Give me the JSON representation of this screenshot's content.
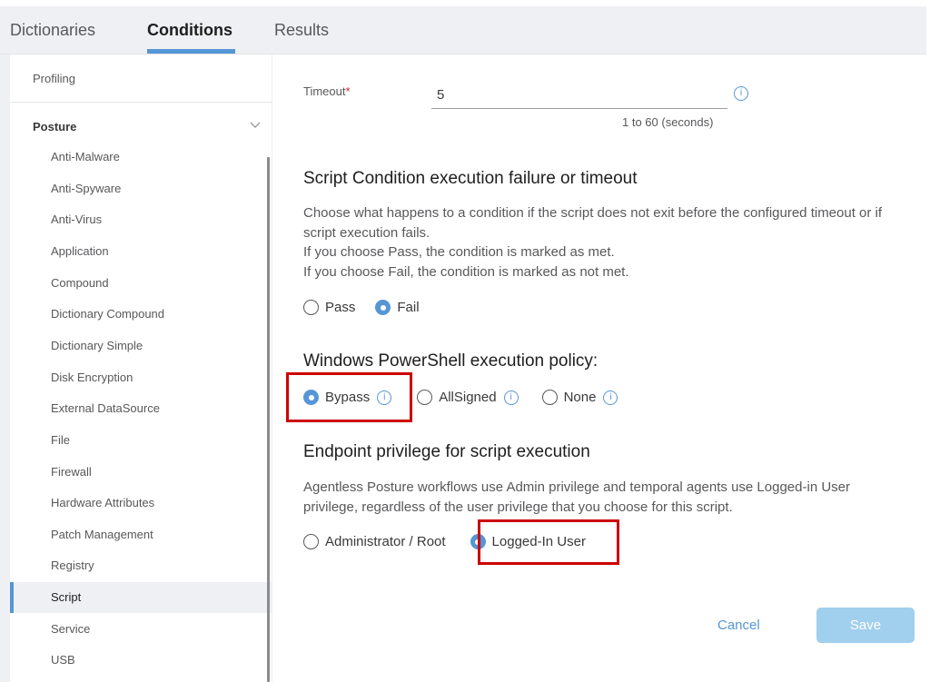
{
  "tabs": [
    {
      "label": "Dictionaries",
      "active": false
    },
    {
      "label": "Conditions",
      "active": true
    },
    {
      "label": "Results",
      "active": false
    }
  ],
  "sidebar": {
    "profiling_label": "Profiling",
    "section_label": "Posture",
    "section_expanded": true,
    "items": [
      {
        "label": "Anti-Malware"
      },
      {
        "label": "Anti-Spyware"
      },
      {
        "label": "Anti-Virus"
      },
      {
        "label": "Application"
      },
      {
        "label": "Compound"
      },
      {
        "label": "Dictionary Compound"
      },
      {
        "label": "Dictionary Simple"
      },
      {
        "label": "Disk Encryption"
      },
      {
        "label": "External DataSource"
      },
      {
        "label": "File"
      },
      {
        "label": "Firewall"
      },
      {
        "label": "Hardware Attributes"
      },
      {
        "label": "Patch Management"
      },
      {
        "label": "Registry"
      },
      {
        "label": "Script",
        "selected": true
      },
      {
        "label": "Service"
      },
      {
        "label": "USB"
      }
    ]
  },
  "form": {
    "timeout": {
      "label": "Timeout",
      "required_marker": "*",
      "value": "5",
      "hint": "1 to 60 (seconds)",
      "info_glyph": "i"
    },
    "failure_section": {
      "title": "Script Condition execution failure or timeout",
      "description_lines": [
        "Choose what happens to a condition if the script does not exit before the configured timeout or if script execution fails.",
        "If you choose Pass, the condition is marked as met.",
        "If you choose Fail, the condition is marked as not met."
      ],
      "options": [
        {
          "label": "Pass",
          "checked": false
        },
        {
          "label": "Fail",
          "checked": true
        }
      ]
    },
    "powershell_section": {
      "title": "Windows PowerShell execution policy:",
      "options": [
        {
          "label": "Bypass",
          "checked": true,
          "info_glyph": "i"
        },
        {
          "label": "AllSigned",
          "checked": false,
          "info_glyph": "i"
        },
        {
          "label": "None",
          "checked": false,
          "info_glyph": "i"
        }
      ]
    },
    "privilege_section": {
      "title": "Endpoint privilege for script execution",
      "description": "Agentless Posture workflows use Admin privilege and temporal agents use Logged-in User privilege, regardless of the user privilege that you choose for this script.",
      "options": [
        {
          "label": "Administrator / Root",
          "checked": false
        },
        {
          "label": "Logged-In User",
          "checked": true
        }
      ]
    }
  },
  "actions": {
    "cancel_label": "Cancel",
    "save_label": "Save",
    "save_enabled": false
  },
  "colors": {
    "accent": "#5596d6",
    "highlight": "#cc0000",
    "save_disabled": "#a1cfee",
    "required": "#cf2030"
  }
}
